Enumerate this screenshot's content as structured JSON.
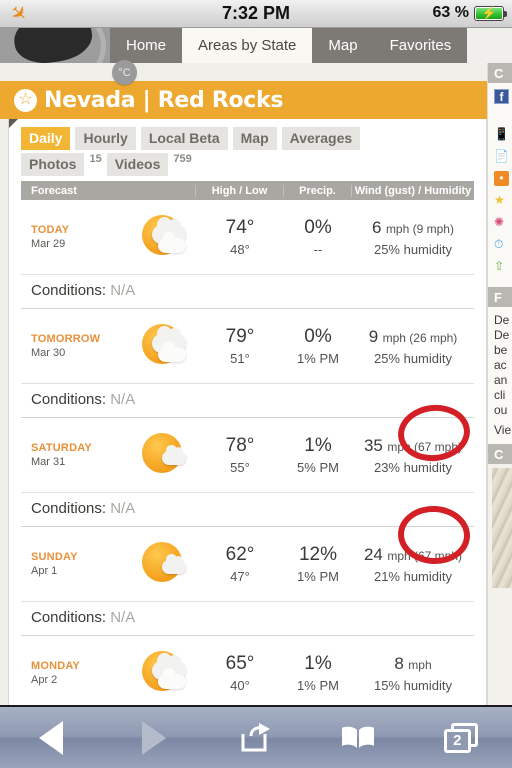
{
  "status_bar": {
    "airplane_icon": "airplane-icon",
    "time": "7:32 PM",
    "battery_percent": "63 %",
    "battery_state": "charging"
  },
  "site_nav": {
    "tabs": [
      {
        "label": "Home",
        "active": false
      },
      {
        "label": "Areas by State",
        "active": true
      },
      {
        "label": "Map",
        "active": false
      },
      {
        "label": "Favorites",
        "active": false
      }
    ]
  },
  "unit_toggle": {
    "label": "°C"
  },
  "header": {
    "star_icon": "star-icon",
    "title": "Nevada | Red Rocks",
    "accent_color": "#eda92f"
  },
  "subtabs": {
    "row1": [
      {
        "label": "Daily",
        "active": true
      },
      {
        "label": "Hourly",
        "active": false
      },
      {
        "label": "Local Beta",
        "active": false
      },
      {
        "label": "Map",
        "active": false
      },
      {
        "label": "Averages",
        "active": false
      }
    ],
    "row2": [
      {
        "label": "Photos",
        "count": "15"
      },
      {
        "label": "Videos",
        "count": "759"
      }
    ]
  },
  "table": {
    "headers": {
      "forecast": "Forecast",
      "high_low": "High / Low",
      "precip": "Precip.",
      "wind": "Wind (gust) / Humidity"
    },
    "conditions_label": "Conditions:",
    "conditions_value": "N/A",
    "rows": [
      {
        "day": "TODAY",
        "date": "Mar 29",
        "icon": "partly-cloudy-icon",
        "high": "74°",
        "low": "48°",
        "precip": "0%",
        "precip_sub": "--",
        "wind": "6",
        "wind_unit": "mph (9 mph)",
        "humidity": "25% humidity",
        "annotated": false
      },
      {
        "day": "TOMORROW",
        "date": "Mar 30",
        "icon": "partly-cloudy-icon",
        "high": "79°",
        "low": "51°",
        "precip": "0%",
        "precip_sub": "1% PM",
        "wind": "9",
        "wind_unit": "mph (26 mph)",
        "humidity": "25% humidity",
        "annotated": false
      },
      {
        "day": "SATURDAY",
        "date": "Mar 31",
        "icon": "mostly-sunny-icon",
        "high": "78°",
        "low": "55°",
        "precip": "1%",
        "precip_sub": "5% PM",
        "wind": "35",
        "wind_unit": "mph (67 mph)",
        "humidity": "23% humidity",
        "annotated": true
      },
      {
        "day": "SUNDAY",
        "date": "Apr 1",
        "icon": "mostly-sunny-icon",
        "high": "62°",
        "low": "47°",
        "precip": "12%",
        "precip_sub": "1% PM",
        "wind": "24",
        "wind_unit": "mph (67 mph)",
        "humidity": "21% humidity",
        "annotated": true
      },
      {
        "day": "MONDAY",
        "date": "Apr 2",
        "icon": "partly-cloudy-icon",
        "high": "65°",
        "low": "40°",
        "precip": "1%",
        "precip_sub": "1% PM",
        "wind": "8",
        "wind_unit": "mph",
        "humidity": "15% humidity",
        "annotated": false
      }
    ]
  },
  "sidebar": {
    "connect_heading": "C",
    "facebook_icon": "facebook-icon",
    "icons": [
      "mobile-icon",
      "page-icon",
      "rss-icon",
      "star-icon",
      "network-icon",
      "clock-icon",
      "upload-icon"
    ],
    "forecast_heading": "F",
    "text_lines": [
      "De",
      "De",
      "be",
      "ac",
      "an",
      "cli",
      "ou"
    ],
    "view_link": "Vie",
    "photos_heading": "C"
  },
  "annotations": {
    "color": "#d31f26",
    "shapes": [
      {
        "name": "saturday-gust-circle",
        "target": "35 mph (67 mph)"
      },
      {
        "name": "sunday-gust-circle",
        "target": "24 mph (67 mph)"
      }
    ]
  },
  "browser_toolbar": {
    "back_icon": "back-arrow-icon",
    "forward_icon": "forward-arrow-icon",
    "share_icon": "share-icon",
    "bookmarks_icon": "bookmarks-icon",
    "tabs_icon": "tabs-icon",
    "tab_count": "2"
  }
}
